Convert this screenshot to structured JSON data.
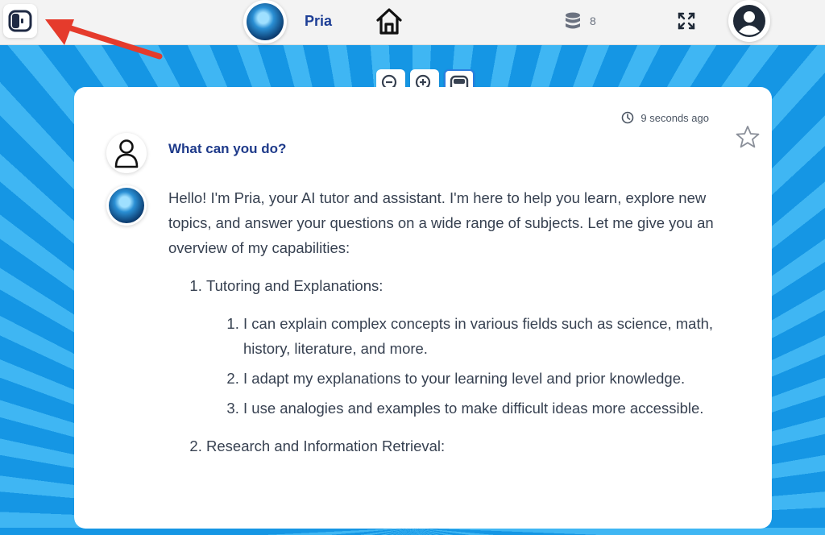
{
  "header": {
    "assistant_name": "Pria",
    "credits": "8",
    "icons": {
      "sidebar": "sidebar-toggle-icon",
      "home": "home-icon",
      "credits": "database-icon",
      "fullscreen": "fullscreen-icon",
      "user": "user-icon"
    }
  },
  "zoom": {
    "icons": [
      "zoom-out-icon",
      "zoom-in-icon",
      "window-icon"
    ]
  },
  "conversation": {
    "timestamp": "9 seconds ago",
    "question": "What can you do?",
    "answer_intro": "Hello! I'm Pria, your AI tutor and assistant. I'm here to help you learn, explore new topics, and answer your questions on a wide range of subjects. Let me give you an overview of my capabilities:",
    "sections": [
      {
        "title": "Tutoring and Explanations:",
        "items": [
          "I can explain complex concepts in various fields such as science, math, history, literature, and more.",
          "I adapt my explanations to your learning level and prior knowledge.",
          "I use analogies and examples to make difficult ideas more accessible."
        ]
      },
      {
        "title": "Research and Information Retrieval:",
        "items": []
      }
    ]
  },
  "colors": {
    "accent": "#1e3f96",
    "background": "#1aa3ec",
    "arrow": "#e53b2c"
  }
}
